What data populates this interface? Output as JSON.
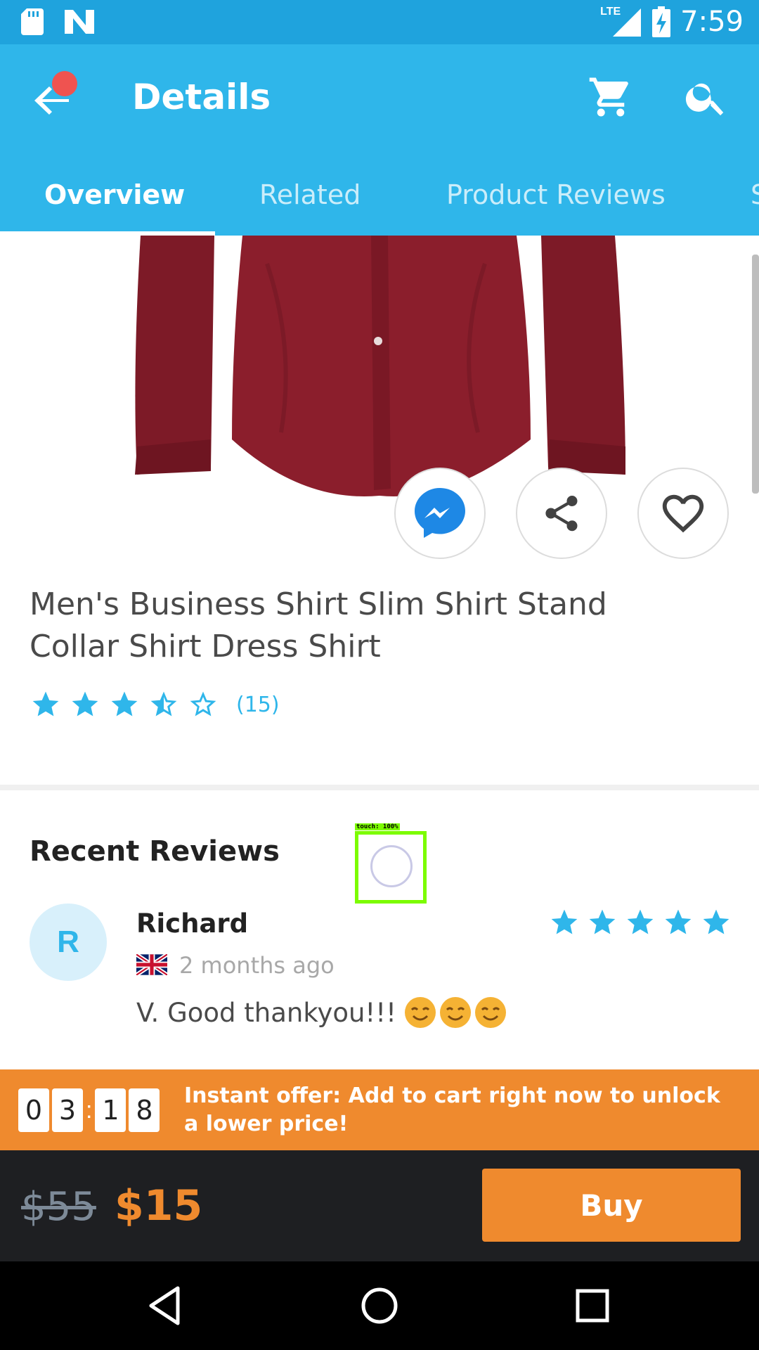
{
  "status_bar": {
    "time": "7:59",
    "network_label": "LTE",
    "icons": [
      "sd-card-icon",
      "n-app-icon",
      "signal-icon",
      "battery-charging-icon"
    ]
  },
  "app_bar": {
    "title": "Details",
    "icons": [
      "back-arrow-icon",
      "cart-icon",
      "search-icon"
    ],
    "tabs": [
      {
        "label": "Overview"
      },
      {
        "label": "Related"
      },
      {
        "label": "Product Reviews"
      },
      {
        "label": "S"
      }
    ],
    "active_tab": "Overview"
  },
  "product": {
    "title": "Men's Business Shirt Slim Shirt Stand Collar Shirt Dress Shirt",
    "rating": 3.5,
    "rating_max": 5,
    "rating_count": "(15)",
    "shirt_color": "#8b1e2c",
    "actions": [
      "messenger-icon",
      "share-icon",
      "heart-icon"
    ]
  },
  "reviews": {
    "heading": "Recent Reviews",
    "items": [
      {
        "avatar_initial": "R",
        "name": "Richard",
        "country_flag": "uk-flag-icon",
        "time": "2 months ago",
        "text": "V. Good thankyou!!!",
        "emojis": [
          "smiling-face-icon",
          "smiling-face-icon",
          "smiling-face-icon"
        ],
        "stars": 5
      }
    ]
  },
  "touch_overlay": {
    "label": "touch: 100%"
  },
  "offer": {
    "countdown": [
      "0",
      "3",
      "1",
      "8"
    ],
    "separator": ":",
    "text": "Instant offer: Add to cart right now to unlock a lower price!"
  },
  "purchase": {
    "old_price": "$55",
    "new_price": "$15",
    "buy_label": "Buy"
  },
  "nav_bar": {
    "icons": [
      "back-triangle-icon",
      "home-circle-icon",
      "recents-square-icon"
    ]
  },
  "colors": {
    "primary": "#2fb6ea",
    "status_bar": "#1fa3dd",
    "accent": "#ef8a2e",
    "bottom_bar": "#1e1f22",
    "star": "#2fb6ea"
  }
}
